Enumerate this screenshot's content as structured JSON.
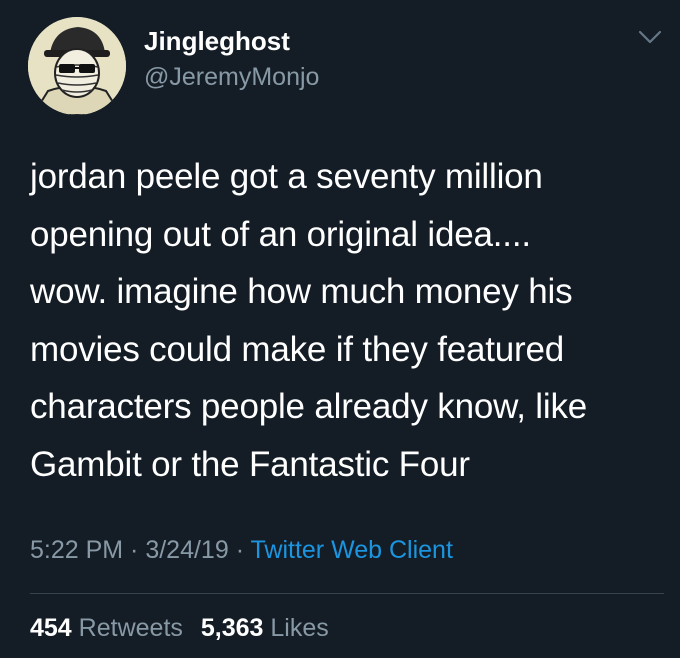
{
  "user": {
    "display_name": "Jingleghost",
    "handle": "@JeremyMonjo",
    "avatar_icon": "masked-character-avatar"
  },
  "menu_icon": "chevron-down-icon",
  "tweet": {
    "lines": [
      "jordan peele got a seventy million",
      "opening out of an original idea....",
      "wow. imagine how much money his",
      "movies could make if they featured",
      "characters people already know, like",
      "Gambit or the Fantastic Four"
    ]
  },
  "meta": {
    "time": "5:22 PM",
    "sep1": " · ",
    "date": "3/24/19",
    "sep2": " · ",
    "source": "Twitter Web Client"
  },
  "stats": {
    "retweets_count": "454",
    "retweets_label": "Retweets",
    "likes_count": "5,363",
    "likes_label": "Likes"
  },
  "colors": {
    "background": "#141d26",
    "text": "#ffffff",
    "secondary": "#8899a6",
    "link": "#1b95e0",
    "divider": "#38444d"
  }
}
